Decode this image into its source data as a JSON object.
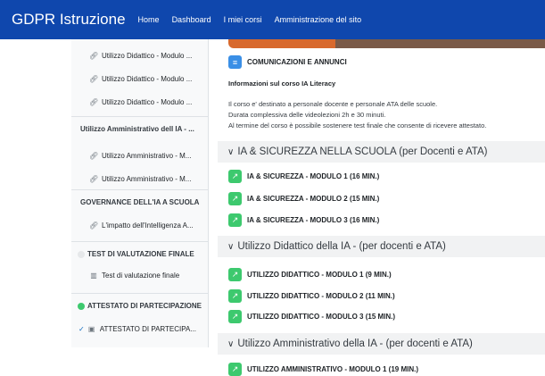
{
  "navbar": {
    "brand": "GDPR Istruzione",
    "links": [
      "Home",
      "Dashboard",
      "I miei corsi",
      "Amministrazione del sito"
    ]
  },
  "index": {
    "items_top": [
      {
        "icon": "link-icon",
        "label": "Utilizzo Didattico - Modulo ..."
      },
      {
        "icon": "link-icon",
        "label": "Utilizzo Didattico - Modulo ..."
      },
      {
        "icon": "link-icon",
        "label": "Utilizzo Didattico - Modulo ..."
      }
    ],
    "sec_amm": "Utilizzo Amministrativo dell IA - ...",
    "items_amm": [
      {
        "icon": "link-icon",
        "label": "Utilizzo Amministrativo - M..."
      },
      {
        "icon": "link-icon",
        "label": "Utilizzo Amministrativo - M..."
      }
    ],
    "sec_gov": "GOVERNANCE DELL'IA A SCUOLA",
    "item_gov": {
      "icon": "link-icon",
      "label": "L'impatto dell'Intelligenza A..."
    },
    "sec_test": "TEST DI VALUTAZIONE FINALE",
    "item_test": {
      "icon": "quiz-icon",
      "label": "Test di valutazione finale"
    },
    "sec_att": "ATTESTATO DI PARTECIPAZIONE",
    "item_att": {
      "icon": "certificate-icon",
      "label": "ATTESTATO DI PARTECIPA..."
    },
    "dot_grey": "#e6e8ea",
    "dot_green": "#3dc96e"
  },
  "main": {
    "announcements": "COMUNICAZIONI E ANNUNCI",
    "info_title": "Informazioni sul corso IA Literacy",
    "info_lines": [
      "Il corso e' destinato a personale docente e personale ATA delle scuole.",
      "Durata complessiva delle videolezioni 2h e 30 minuti.",
      "Al termine del corso è possibile sostenere test finale che consente di ricevere attestato."
    ],
    "sections": [
      {
        "title": "IA & SICUREZZA NELLA SCUOLA (per Docenti e ATA)",
        "activities": [
          "IA & SICUREZZA - MODULO 1 (16 MIN.)",
          "IA & SICUREZZA - MODULO 2 (15 MIN.)",
          "IA & SICUREZZA - MODULO 3 (16 MIN.)"
        ]
      },
      {
        "title": "Utilizzo Didattico della IA - (per docenti e ATA)",
        "activities": [
          "UTILIZZO DIDATTICO - MODULO 1 (9 MIN.)",
          "UTILIZZO DIDATTICO - MODULO 2 (11 MIN.)",
          "UTILIZZO DIDATTICO - MODULO 3 (15 MIN.)"
        ]
      },
      {
        "title": "Utilizzo Amministrativo della IA - (per docenti e ATA)",
        "activities": [
          "UTILIZZO AMMINISTRATIVO - MODULO 1 (19 MIN.)"
        ]
      }
    ]
  },
  "colors": {
    "navbar": "#0f47ad",
    "url_icon": "#3dc96e",
    "forum_icon": "#3a8fe6"
  }
}
